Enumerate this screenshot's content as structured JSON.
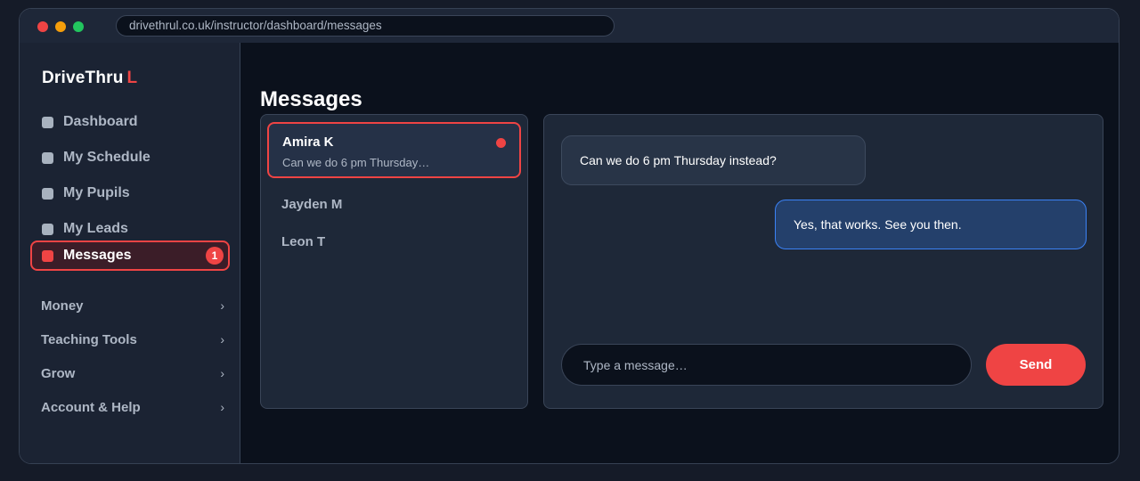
{
  "browser": {
    "url": "drivethrul.co.uk/instructor/dashboard/messages"
  },
  "sidebar": {
    "brand": {
      "name": "DriveThru",
      "accent": "L"
    },
    "items": [
      {
        "label": "Dashboard"
      },
      {
        "label": "My Schedule"
      },
      {
        "label": "My Pupils"
      },
      {
        "label": "My Leads"
      },
      {
        "label": "Messages",
        "badge": "1",
        "active": true
      }
    ],
    "groups": [
      {
        "label": "Money",
        "chevron": "›"
      },
      {
        "label": "Teaching Tools",
        "chevron": "›"
      },
      {
        "label": "Grow",
        "chevron": "›"
      },
      {
        "label": "Account & Help",
        "chevron": "›"
      }
    ]
  },
  "main": {
    "title": "Messages",
    "conversations": [
      {
        "name": "Amira K",
        "preview": "Can we do 6 pm Thursday…",
        "unread": true,
        "active": true
      },
      {
        "name": "Jayden M"
      },
      {
        "name": "Leon T"
      }
    ],
    "chat": {
      "messages": [
        {
          "direction": "incoming",
          "text": "Can we do 6 pm Thursday instead?"
        },
        {
          "direction": "outgoing",
          "text": "Yes, that works. See you then."
        }
      ],
      "input_placeholder": "Type a message…",
      "send_label": "Send"
    }
  },
  "colors": {
    "accent": "#ef4444",
    "outgoing_border": "#3b82f6",
    "background": "#0b111c"
  }
}
